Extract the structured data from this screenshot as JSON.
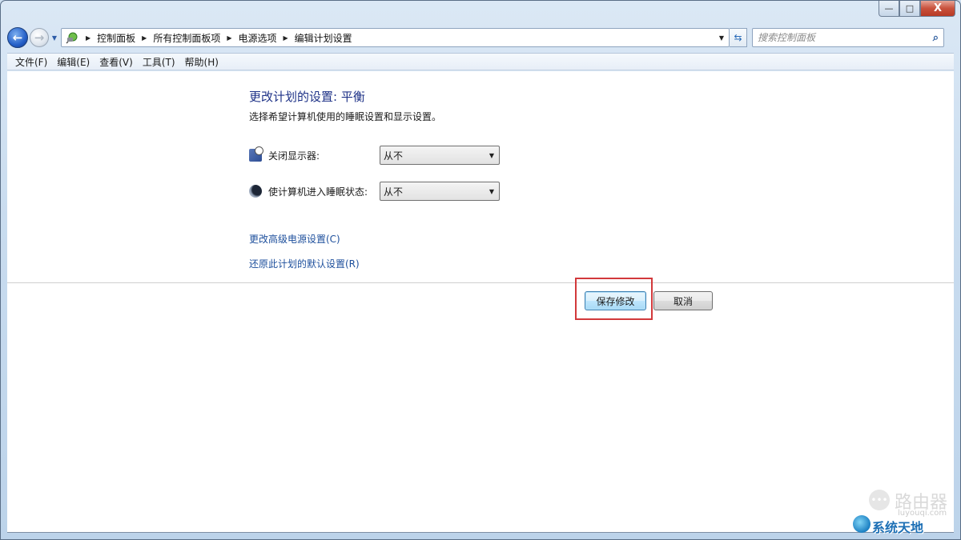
{
  "window": {
    "controls": {
      "minimize_icon": "—",
      "maximize_icon": "□",
      "close_icon": "X"
    }
  },
  "navigation": {
    "back_icon": "←",
    "forward_icon": "→",
    "history_icon": "▼",
    "address_icon": "control-panel-icon",
    "breadcrumbs": [
      {
        "label": "控制面板"
      },
      {
        "label": "所有控制面板项"
      },
      {
        "label": "电源选项"
      },
      {
        "label": "编辑计划设置"
      }
    ],
    "crumb_separator": "▶",
    "dropdown_icon": "▼",
    "refresh_icon": "⇆",
    "search": {
      "placeholder": "搜索控制面板",
      "value": "",
      "icon": "⌕"
    }
  },
  "menu": {
    "items": [
      {
        "label": "文件(F)"
      },
      {
        "label": "编辑(E)"
      },
      {
        "label": "查看(V)"
      },
      {
        "label": "工具(T)"
      },
      {
        "label": "帮助(H)"
      }
    ]
  },
  "main": {
    "title": "更改计划的设置: 平衡",
    "subtitle": "选择希望计算机使用的睡眠设置和显示设置。",
    "settings": [
      {
        "label": "关闭显示器:",
        "icon": "monitor-icon",
        "value": "从不"
      },
      {
        "label": "使计算机进入睡眠状态:",
        "icon": "moon-icon",
        "value": "从不"
      }
    ],
    "select_arrow": "▼",
    "links": [
      {
        "label": "更改高级电源设置(C)"
      },
      {
        "label": "还原此计划的默认设置(R)"
      }
    ],
    "buttons": {
      "save": "保存修改",
      "cancel": "取消"
    },
    "highlight_color": "#d2393b"
  },
  "watermark": {
    "router_text": "路由器",
    "domain": "luyouqi.com",
    "brand": "系统天地"
  }
}
